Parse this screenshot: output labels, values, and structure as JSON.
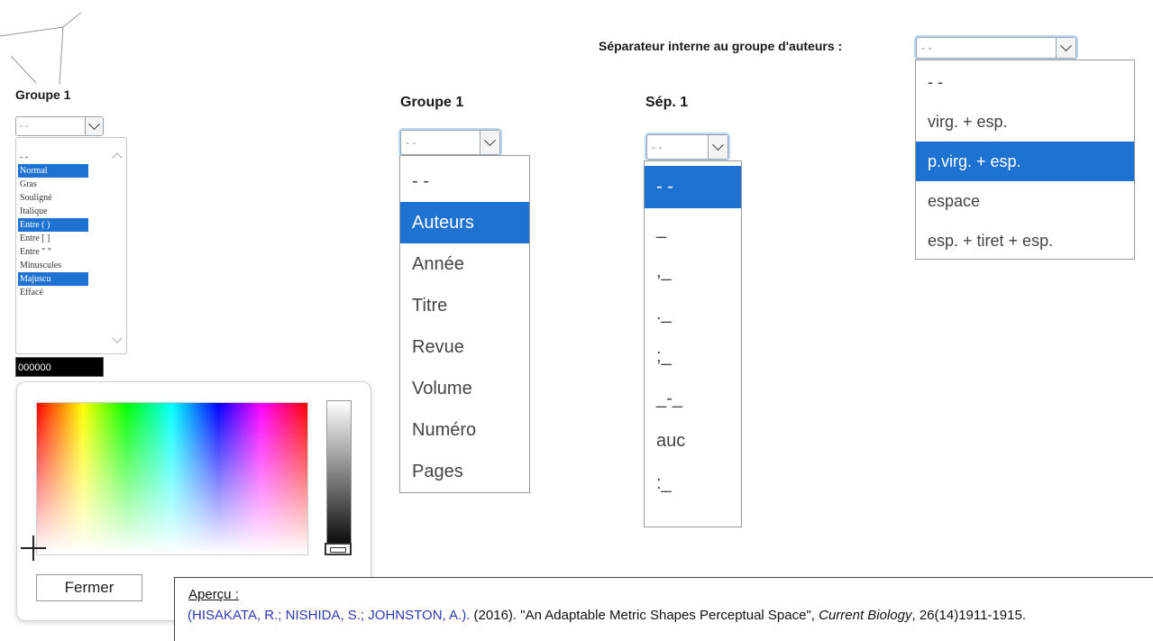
{
  "left_panel": {
    "group_label": "Groupe 1",
    "select_value": "- -",
    "style_options": [
      {
        "label": "- -",
        "selected": false
      },
      {
        "label": "Normal",
        "selected": true
      },
      {
        "label": "Gras",
        "selected": false
      },
      {
        "label": "Souligné",
        "selected": false
      },
      {
        "label": "Italique",
        "selected": false
      },
      {
        "label": "Entre ( )",
        "selected": true
      },
      {
        "label": "Entre [ ]",
        "selected": false
      },
      {
        "label": "Entre \" \"",
        "selected": false
      },
      {
        "label": "Minuscules",
        "selected": false
      },
      {
        "label": "Majuscu",
        "selected": true
      },
      {
        "label": "Effacé",
        "selected": false
      }
    ],
    "color_value": "000000"
  },
  "color_picker": {
    "close_label": "Fermer"
  },
  "group_dropdown": {
    "label": "Groupe 1",
    "value": "- -",
    "options": [
      {
        "label": "- -",
        "selected": false
      },
      {
        "label": "Auteurs",
        "selected": true
      },
      {
        "label": "Année",
        "selected": false
      },
      {
        "label": "Titre",
        "selected": false
      },
      {
        "label": "Revue",
        "selected": false
      },
      {
        "label": "Volume",
        "selected": false
      },
      {
        "label": "Numéro",
        "selected": false
      },
      {
        "label": "Pages",
        "selected": false
      }
    ]
  },
  "sep_dropdown": {
    "label": "Sép. 1",
    "value": "- -",
    "options": [
      {
        "label": "- -",
        "selected": true
      },
      {
        "label": "_",
        "selected": false
      },
      {
        "label": ",_",
        "selected": false
      },
      {
        "label": "._",
        "selected": false
      },
      {
        "label": ";_",
        "selected": false
      },
      {
        "label": "_-_",
        "selected": false
      },
      {
        "label": "auc",
        "selected": false
      },
      {
        "label": ":_",
        "selected": false
      }
    ]
  },
  "author_sep_dropdown": {
    "label": "Séparateur interne au groupe d'auteurs :",
    "value": "- -",
    "options": [
      {
        "label": "- -",
        "selected": false
      },
      {
        "label": "virg. + esp.",
        "selected": false
      },
      {
        "label": "p.virg. + esp.",
        "selected": true
      },
      {
        "label": "espace",
        "selected": false
      },
      {
        "label": "esp. + tiret + esp.",
        "selected": false
      }
    ]
  },
  "preview": {
    "title": "Aperçu :",
    "authors": "(HISAKATA, R.; NISHIDA, S.; JOHNSTON, A.).",
    "year_title": " (2016). \"An Adaptable Metric Shapes Perceptual Space\", ",
    "journal": "Current Biology",
    "volume_pages": ", 26(14)1911-1915."
  },
  "colors": {
    "selection_blue": "#1e72d2",
    "author_text_blue": "#2f3bb0"
  }
}
